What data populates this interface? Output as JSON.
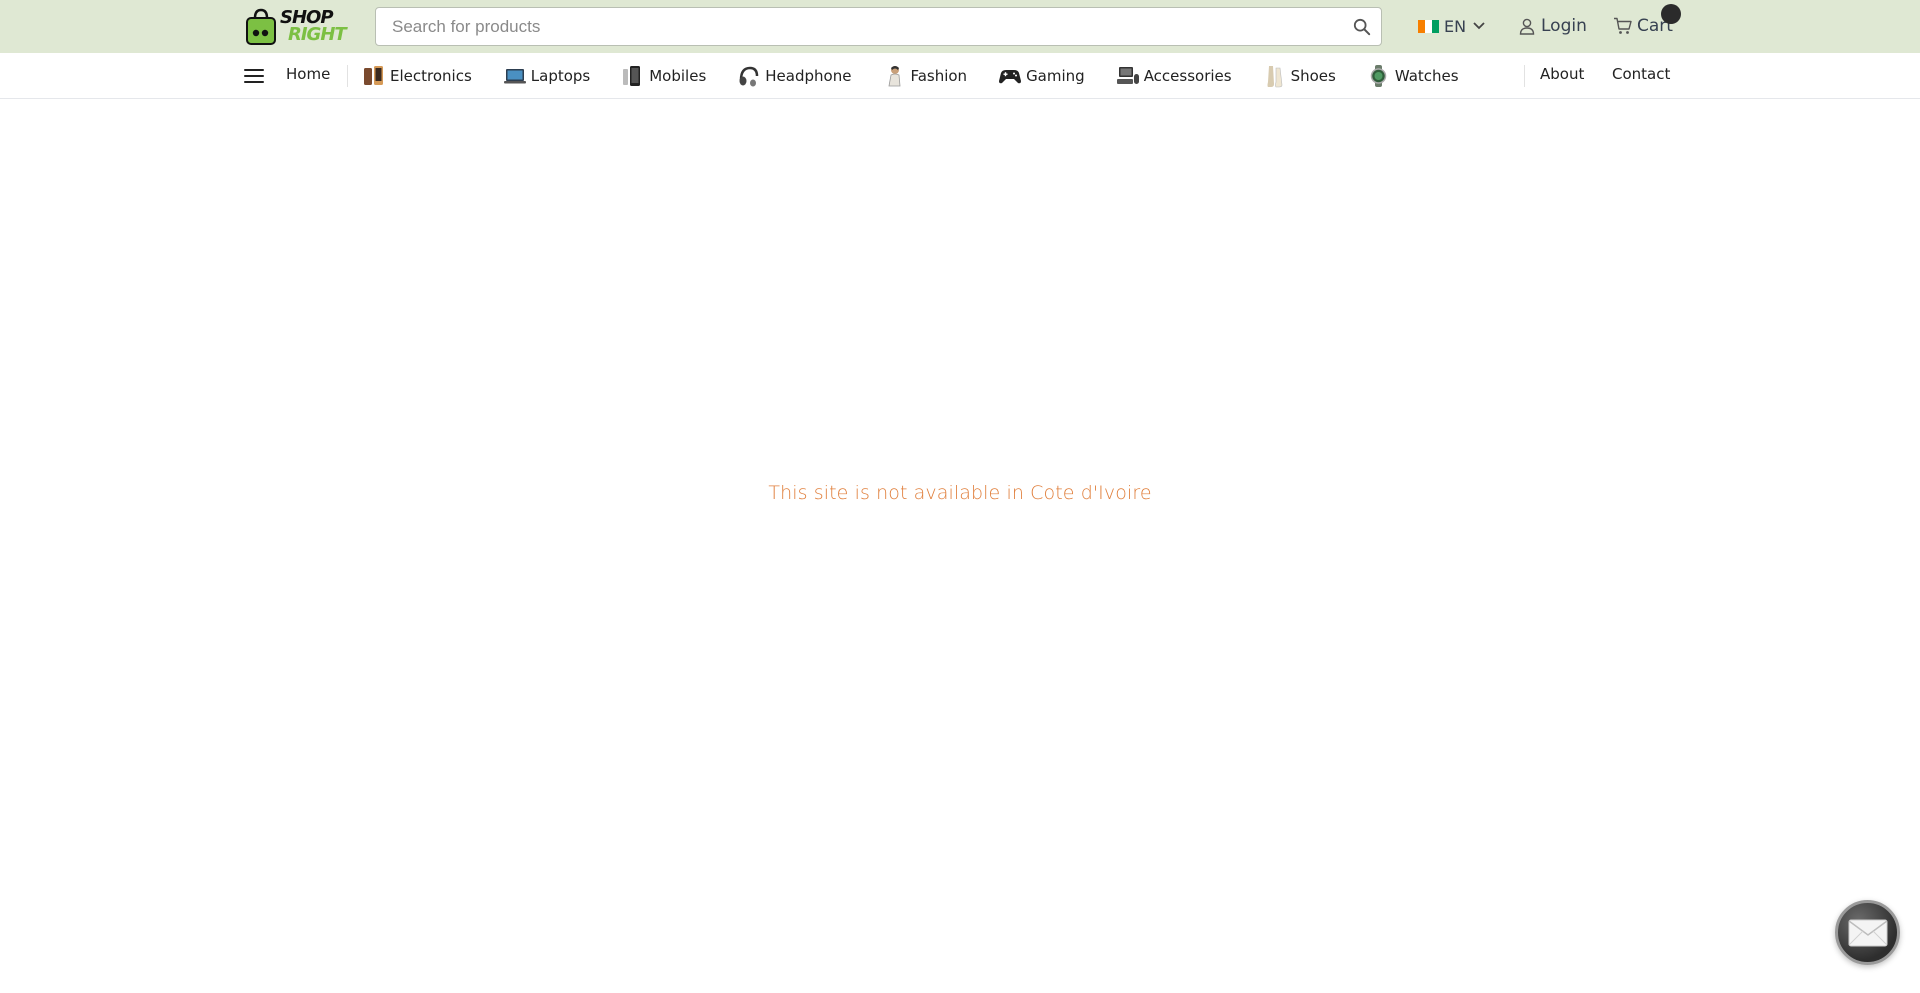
{
  "header": {
    "logo": {
      "line1": "SHOP",
      "line2": "RIGHT"
    },
    "search": {
      "placeholder": "Search for products",
      "value": ""
    },
    "language": {
      "code": "EN",
      "flag_colors": [
        "#f77f00",
        "#ffffff",
        "#009e60"
      ]
    },
    "login_label": "Login",
    "cart_label": "Cart"
  },
  "nav": {
    "home": "Home",
    "categories": [
      {
        "label": "Electronics",
        "icon": "electronics-icon"
      },
      {
        "label": "Laptops",
        "icon": "laptop-icon"
      },
      {
        "label": "Mobiles",
        "icon": "mobile-icon"
      },
      {
        "label": "Headphone",
        "icon": "headphone-icon"
      },
      {
        "label": "Fashion",
        "icon": "fashion-icon"
      },
      {
        "label": "Gaming",
        "icon": "gamepad-icon"
      },
      {
        "label": "Accessories",
        "icon": "accessories-icon"
      },
      {
        "label": "Shoes",
        "icon": "shoes-icon"
      },
      {
        "label": "Watches",
        "icon": "watch-icon"
      }
    ],
    "about": "About",
    "contact": "Contact"
  },
  "main": {
    "notice": "This site is not available in Cote d'Ivoire"
  },
  "colors": {
    "topbar_bg": "#dfe8d3",
    "notice_text": "#e07f3c",
    "brand_green": "#7cc043"
  }
}
